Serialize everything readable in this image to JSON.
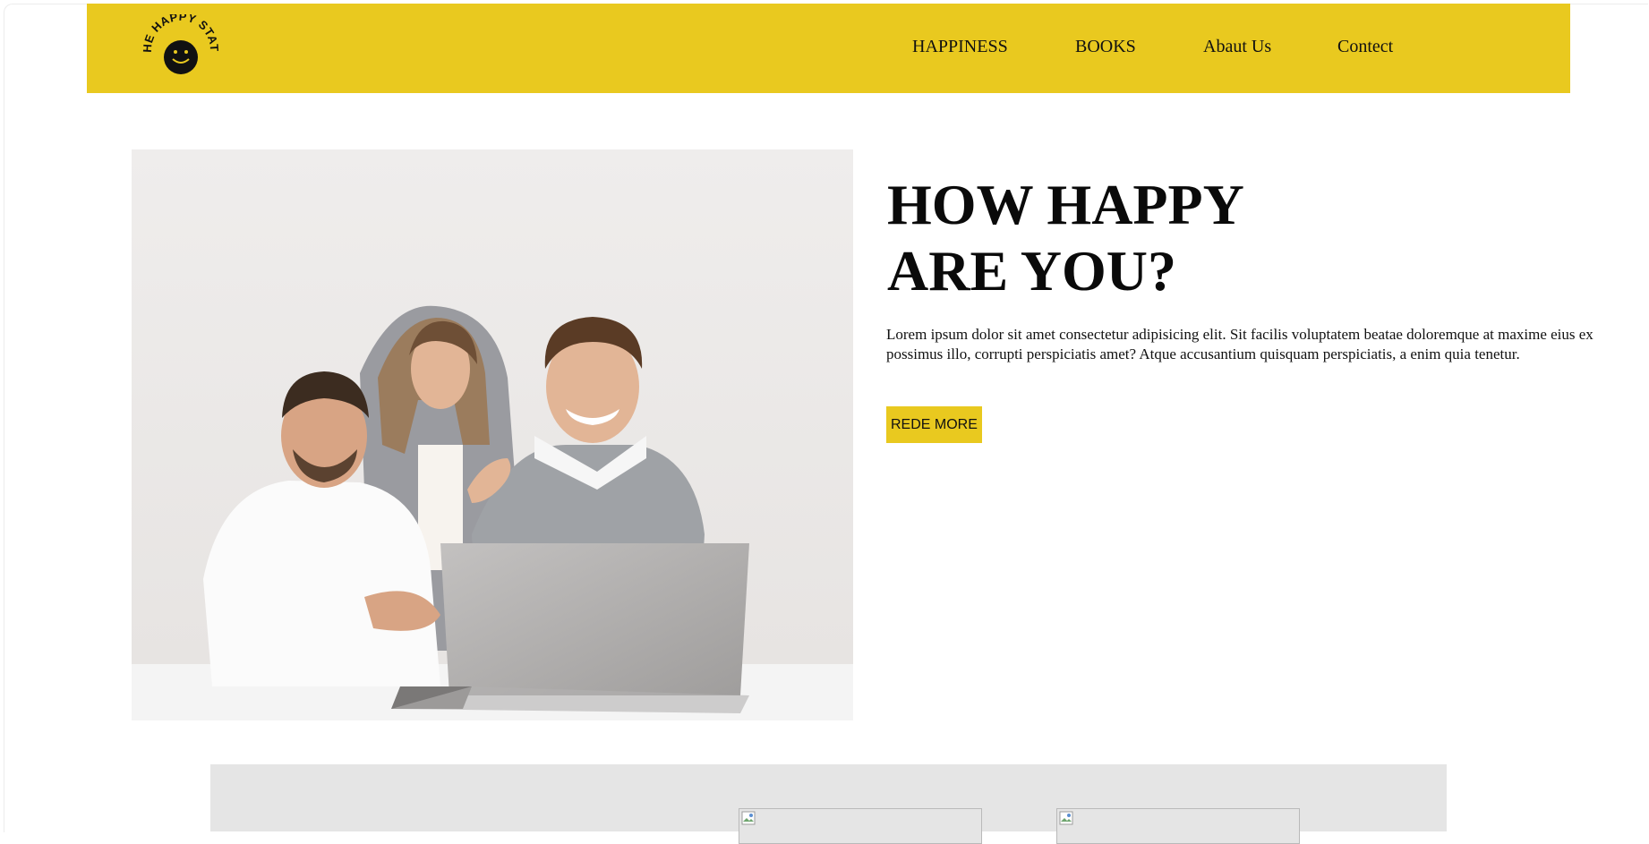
{
  "brand": {
    "logo_text": "THE HAPPY STATS"
  },
  "nav": {
    "items": [
      {
        "label": "HAPPINESS"
      },
      {
        "label": "BOOKS"
      },
      {
        "label": "Abaut Us"
      },
      {
        "label": "Contect"
      }
    ]
  },
  "hero": {
    "title_line1": "HOW HAPPY",
    "title_line2": "ARE YOU?",
    "paragraph": "Lorem ipsum dolor sit amet consectetur adipisicing elit. Sit facilis voluptatem beatae doloremque at maxime eius ex possimus illo, corrupti perspiciatis amet? Atque accusantium quisquam perspiciatis, a enim quia tenetur.",
    "button_label": "REDE MORE",
    "image_icon": "team-photo"
  },
  "colors": {
    "accent": "#e9c91f",
    "section_gray": "#e5e5e5",
    "text": "#111111"
  },
  "gallery": {
    "images": [
      {
        "icon": "broken-image-icon"
      },
      {
        "icon": "broken-image-icon"
      }
    ]
  }
}
